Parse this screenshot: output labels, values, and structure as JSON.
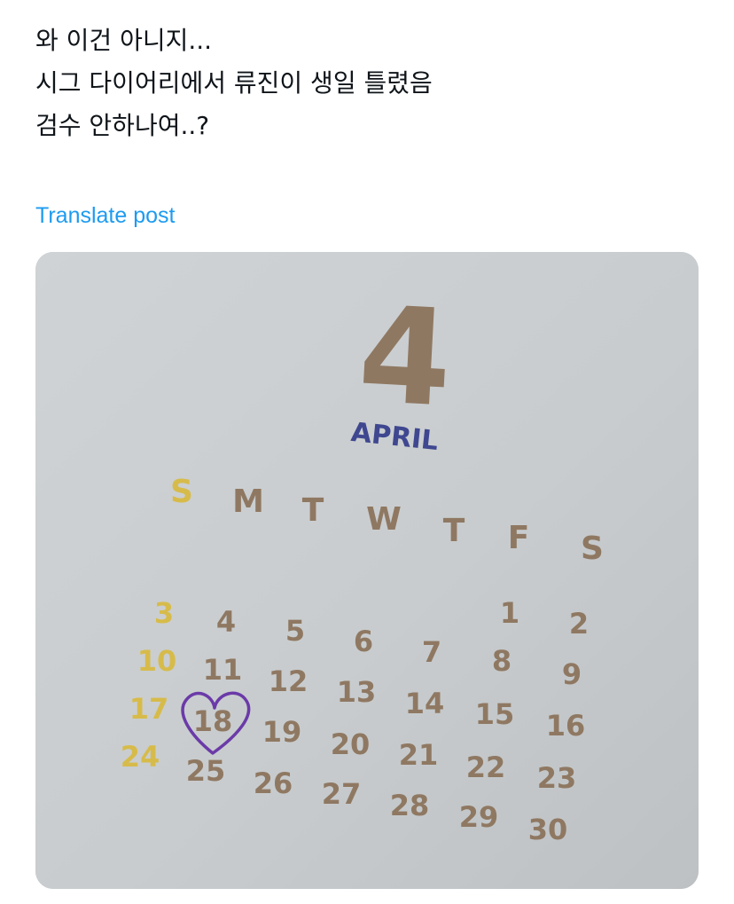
{
  "post": {
    "lines": [
      "와 이건 아니지...",
      "시그 다이어리에서 류진이 생일 틀렸음",
      "검수 안하나여..?"
    ],
    "translate_label": "Translate post"
  },
  "calendar_photo": {
    "month_number": "4",
    "month_name": "APRIL",
    "weekdays": [
      "S",
      "M",
      "T",
      "W",
      "T",
      "F",
      "S"
    ],
    "rows": [
      [
        "3",
        "4",
        "5",
        "6",
        "7",
        "1",
        "2"
      ],
      [
        "10",
        "11",
        "12",
        "13",
        "14",
        "8",
        "9"
      ],
      [
        "17",
        "18",
        "19",
        "20",
        "21",
        "15",
        "16"
      ],
      [
        "24",
        "25",
        "26",
        "27",
        "28",
        "22",
        "23"
      ],
      [
        "",
        "",
        "",
        "",
        "",
        "29",
        "30"
      ]
    ],
    "circled_date": "18",
    "colors": {
      "paper": "#c9cdd0",
      "digits": "#8f7862",
      "sunday": "#d7bb4a",
      "month_name": "#3f4790",
      "heart": "#6b3aa8"
    }
  }
}
